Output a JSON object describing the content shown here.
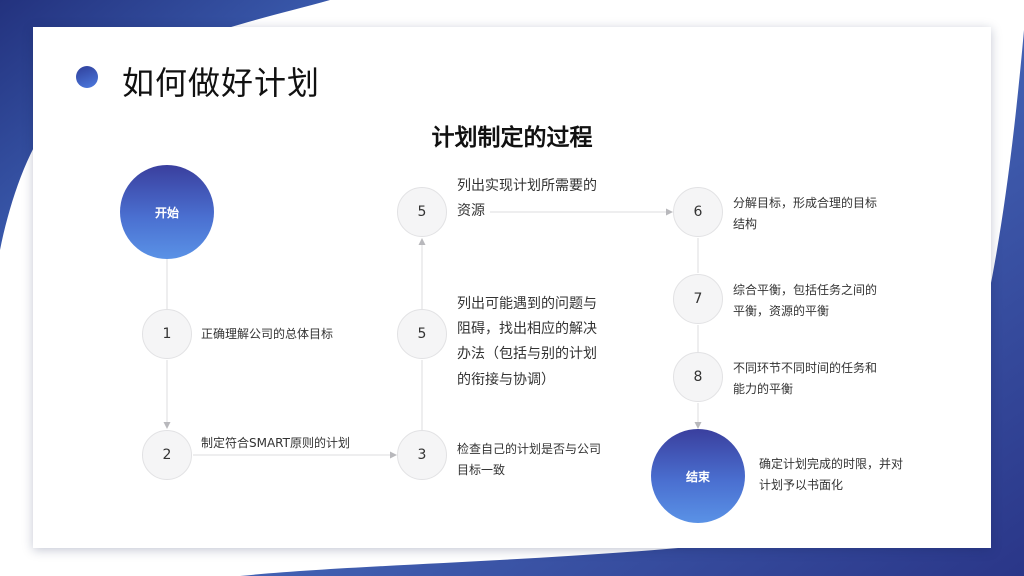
{
  "header": {
    "title": "如何做好计划",
    "subtitle": "计划制定的过程"
  },
  "flow": {
    "start": "开始",
    "end": "结束",
    "steps": [
      {
        "num": "1",
        "text": [
          "正确理解公司的总体目标"
        ]
      },
      {
        "num": "2",
        "text": [
          "制定符合SMART原则的计划"
        ]
      },
      {
        "num": "3",
        "text": [
          "检查自己的计划是否与公司",
          "目标一致"
        ]
      },
      {
        "num": "5",
        "text": [
          "列出可能遇到的问题与",
          "阻碍，找出相应的解决",
          "办法（包括与别的计划",
          "的衔接与协调）"
        ]
      },
      {
        "num": "5",
        "text": [
          "列出实现计划所需要的",
          "资源"
        ]
      },
      {
        "num": "6",
        "text": [
          "分解目标，形成合理的目标",
          "结构"
        ]
      },
      {
        "num": "7",
        "text": [
          "综合平衡，包括任务之间的",
          "平衡，资源的平衡"
        ]
      },
      {
        "num": "8",
        "text": [
          "不同环节不同时间的任务和",
          "能力的平衡"
        ]
      }
    ],
    "end_text": [
      "确定计划完成的时限，并对",
      "计划予以书面化"
    ]
  },
  "colors": {
    "accent_dark": "#2f3f9a",
    "accent_light": "#5a92e6",
    "node_fill": "#f5f5f6",
    "connector": "#dcdcdf"
  }
}
